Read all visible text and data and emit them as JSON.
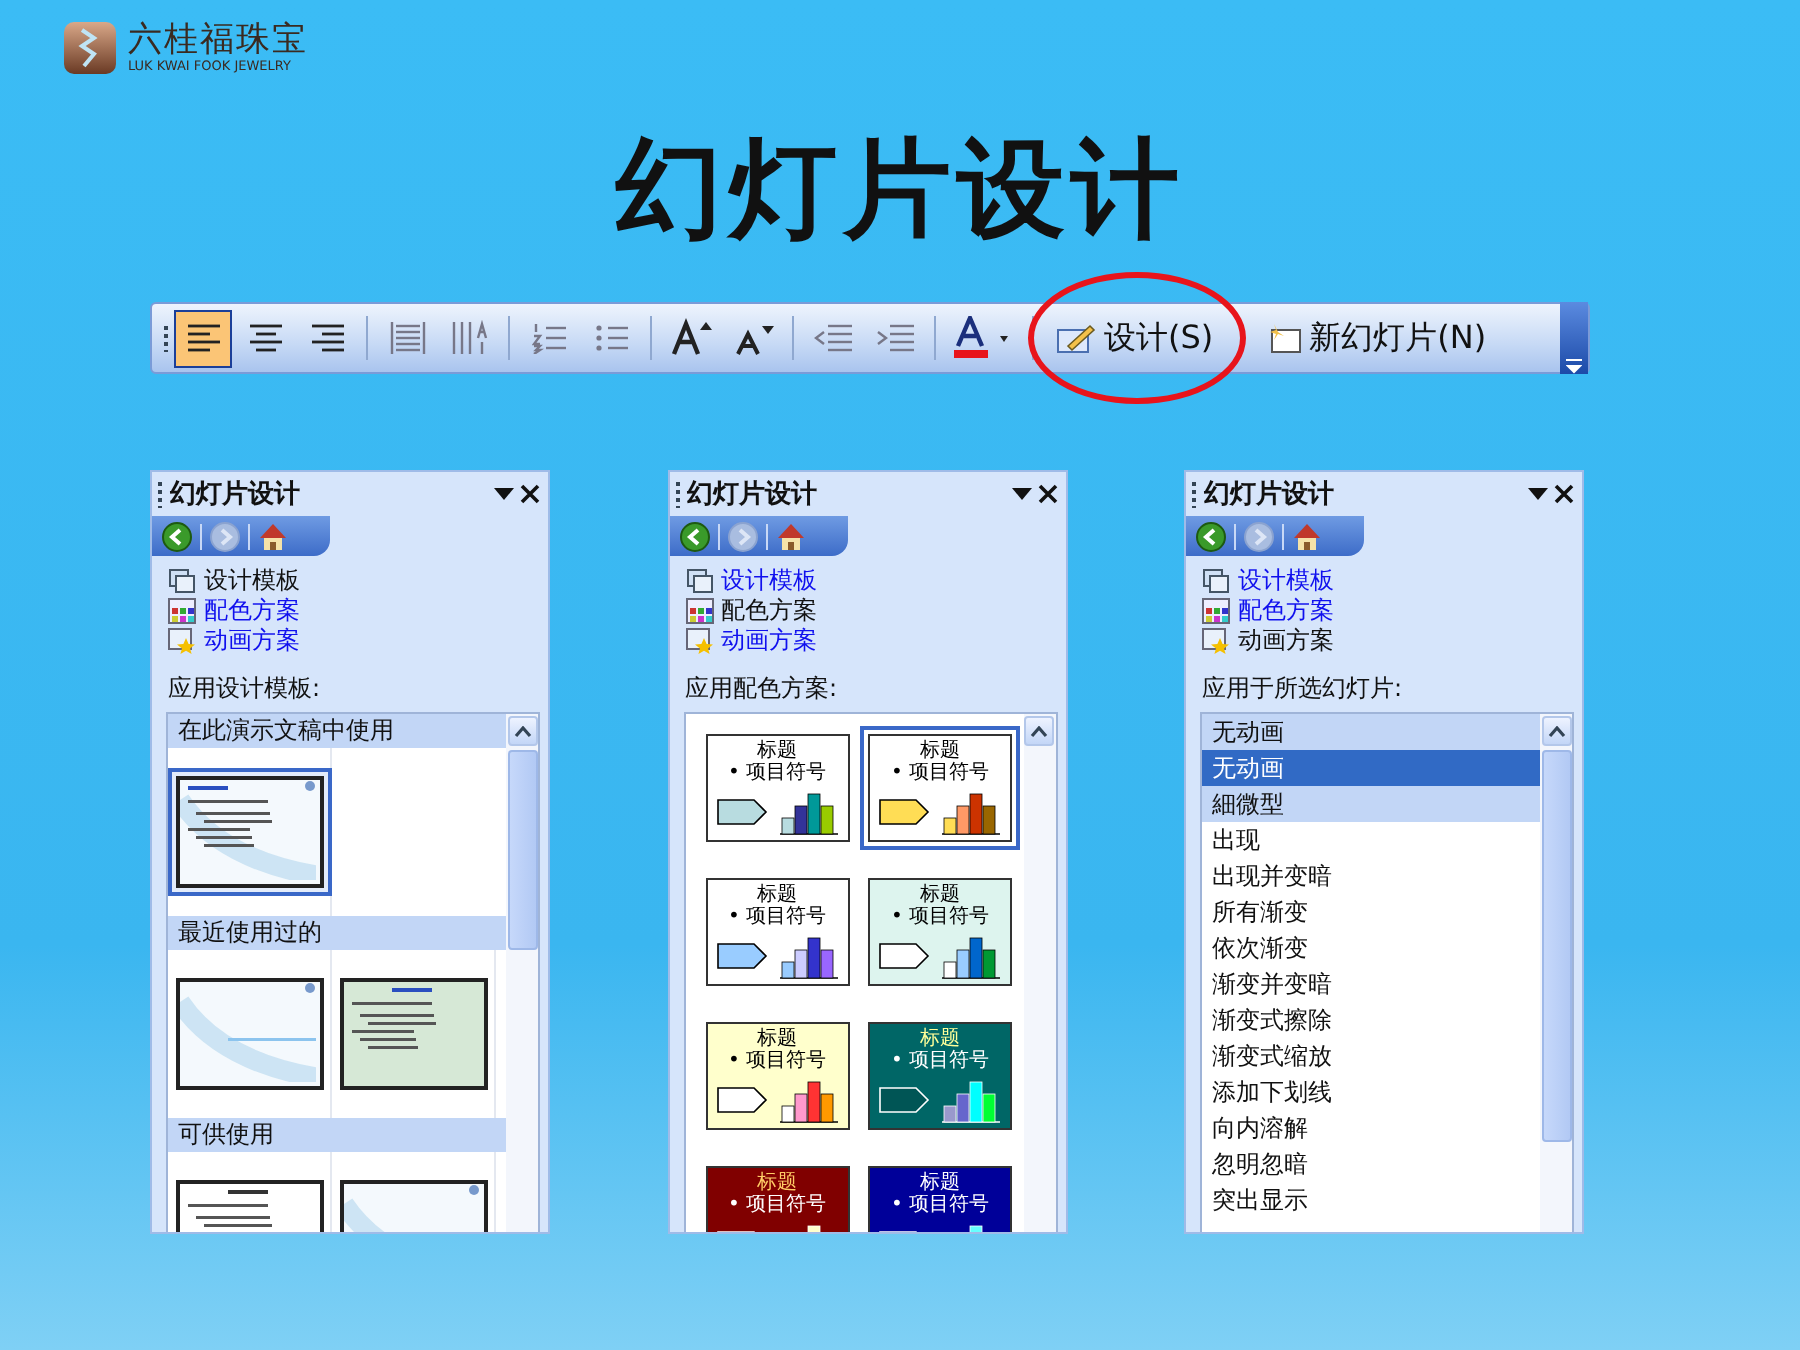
{
  "logo": {
    "name": "六桂福珠宝",
    "subtitle": "LUK KWAI FOOK JEWELRY"
  },
  "title": "幻灯片设计",
  "toolbar": {
    "tool_groups": [
      [
        {
          "kind": "align-left",
          "selected": true
        },
        {
          "kind": "align-center",
          "selected": false
        },
        {
          "kind": "align-right",
          "selected": false
        }
      ],
      [
        {
          "kind": "distribute",
          "selected": false
        },
        {
          "kind": "vertical-text",
          "selected": false
        }
      ],
      [
        {
          "kind": "numbering",
          "selected": false
        },
        {
          "kind": "bullets",
          "selected": false
        }
      ],
      [
        {
          "kind": "grow-font",
          "selected": false
        },
        {
          "kind": "shrink-font",
          "selected": false
        }
      ],
      [
        {
          "kind": "outdent",
          "selected": false
        },
        {
          "kind": "indent",
          "selected": false
        }
      ],
      [
        {
          "kind": "font-color",
          "selected": false
        }
      ]
    ],
    "buttons": [
      {
        "kind": "design",
        "label": "设计(S)",
        "highlighted": true
      },
      {
        "kind": "new-slide",
        "label": "新幻灯片(N)",
        "highlighted": false
      }
    ]
  },
  "panes": [
    {
      "kind": "templates",
      "title": "幻灯片设计",
      "links": [
        {
          "label": "设计模板",
          "current": true
        },
        {
          "label": "配色方案",
          "current": false
        },
        {
          "label": "动画方案",
          "current": false
        }
      ],
      "section_label": "应用设计模板:",
      "groups": [
        {
          "heading": "在此演示文稿中使用",
          "templates": [
            {
              "selected": true
            }
          ]
        },
        {
          "heading": "最近使用过的",
          "templates": [
            {
              "selected": false
            },
            {
              "selected": false
            }
          ]
        },
        {
          "heading": "可供使用",
          "templates": [
            {
              "selected": false
            },
            {
              "selected": false
            }
          ]
        }
      ]
    },
    {
      "kind": "schemes",
      "title": "幻灯片设计",
      "links": [
        {
          "label": "设计模板",
          "current": false
        },
        {
          "label": "配色方案",
          "current": true
        },
        {
          "label": "动画方案",
          "current": false
        }
      ],
      "section_label": "应用配色方案:",
      "schemes": [
        {
          "title": "标题",
          "bullet": "• 项目符号",
          "selected": false,
          "color": "#ffffff"
        },
        {
          "title": "标题",
          "bullet": "• 项目符号",
          "selected": true,
          "color": "#ffffff"
        },
        {
          "title": "标题",
          "bullet": "• 项目符号",
          "selected": false,
          "color": "#ffffff"
        },
        {
          "title": "标题",
          "bullet": "• 项目符号",
          "selected": false,
          "color": "#ddf4ee"
        },
        {
          "title": "标题",
          "bullet": "• 项目符号",
          "selected": false,
          "color": "#ffffcc"
        },
        {
          "title": "标题",
          "bullet": "• 项目符号",
          "selected": false,
          "color": "#006666"
        },
        {
          "title": "标题",
          "bullet": "• 项目符号",
          "selected": false,
          "color": "#800000"
        },
        {
          "title": "标题",
          "bullet": "• 项目符号",
          "selected": false,
          "color": "#000099"
        }
      ]
    },
    {
      "kind": "animations",
      "title": "幻灯片设计",
      "links": [
        {
          "label": "设计模板",
          "current": false
        },
        {
          "label": "配色方案",
          "current": false
        },
        {
          "label": "动画方案",
          "current": true
        }
      ],
      "section_label": "应用于所选幻灯片:",
      "items": [
        {
          "kind": "group",
          "label": "无动画",
          "selected": false
        },
        {
          "kind": "item",
          "label": "无动画",
          "selected": true
        },
        {
          "kind": "group",
          "label": "細微型",
          "selected": false
        },
        {
          "kind": "item",
          "label": "出现",
          "selected": false
        },
        {
          "kind": "item",
          "label": "出现并变暗",
          "selected": false
        },
        {
          "kind": "item",
          "label": "所有渐变",
          "selected": false
        },
        {
          "kind": "item",
          "label": "依次渐变",
          "selected": false
        },
        {
          "kind": "item",
          "label": "渐变并变暗",
          "selected": false
        },
        {
          "kind": "item",
          "label": "渐变式擦除",
          "selected": false
        },
        {
          "kind": "item",
          "label": "渐变式缩放",
          "selected": false
        },
        {
          "kind": "item",
          "label": "添加下划线",
          "selected": false
        },
        {
          "kind": "item",
          "label": "向内溶解",
          "selected": false
        },
        {
          "kind": "item",
          "label": "忽明忽暗",
          "selected": false
        },
        {
          "kind": "item",
          "label": "突出显示",
          "selected": false
        }
      ]
    }
  ]
}
